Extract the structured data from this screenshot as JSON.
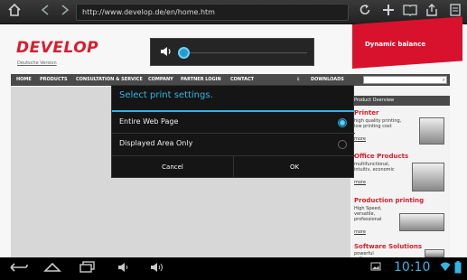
{
  "browser": {
    "url": "http://www.develop.de/en/home.htm",
    "icons": [
      "home-icon",
      "back-icon",
      "forward-icon",
      "refresh-icon",
      "new-tab-icon",
      "bookmarks-icon",
      "share-icon",
      "menu-icon"
    ]
  },
  "website": {
    "logo": "DEVELOP",
    "logo_sub": "Deutsche Version",
    "banner": "Dynamic balance",
    "nav": [
      "HOME",
      "PRODUCTS",
      "CONSULTATION & SERVICE",
      "COMPANY",
      "PARTNER LOGIN",
      "CONTACT",
      "DOWNLOADS"
    ],
    "sidebar": {
      "header": "Product Overview",
      "products": [
        {
          "title": "Printer",
          "text": "high quality printing, low printing cost",
          "more": "more"
        },
        {
          "title": "Office Products",
          "text": "multifunctional, intuitiv, economic",
          "more": "more"
        },
        {
          "title": "Production printing",
          "text": "High Speed, versatile, professional",
          "more": "more"
        },
        {
          "title": "Software Solutions",
          "text": "powerful software",
          "more": "more"
        }
      ]
    }
  },
  "volume": {
    "icon": "speaker-icon",
    "level": 0.0
  },
  "dialog": {
    "title": "Select print settings.",
    "options": [
      {
        "label": "Entire Web Page",
        "selected": true
      },
      {
        "label": "Displayed Area Only",
        "selected": false
      }
    ],
    "cancel": "Cancel",
    "ok": "OK"
  },
  "system_bar": {
    "icons": [
      "back-icon",
      "home-icon",
      "recent-apps-icon",
      "volume-down-icon",
      "volume-up-icon",
      "screenshot-icon",
      "wifi-icon",
      "battery-icon"
    ],
    "time": "10:10"
  },
  "colors": {
    "accent": "#35b5e5",
    "brand_red": "#d91d2c"
  }
}
